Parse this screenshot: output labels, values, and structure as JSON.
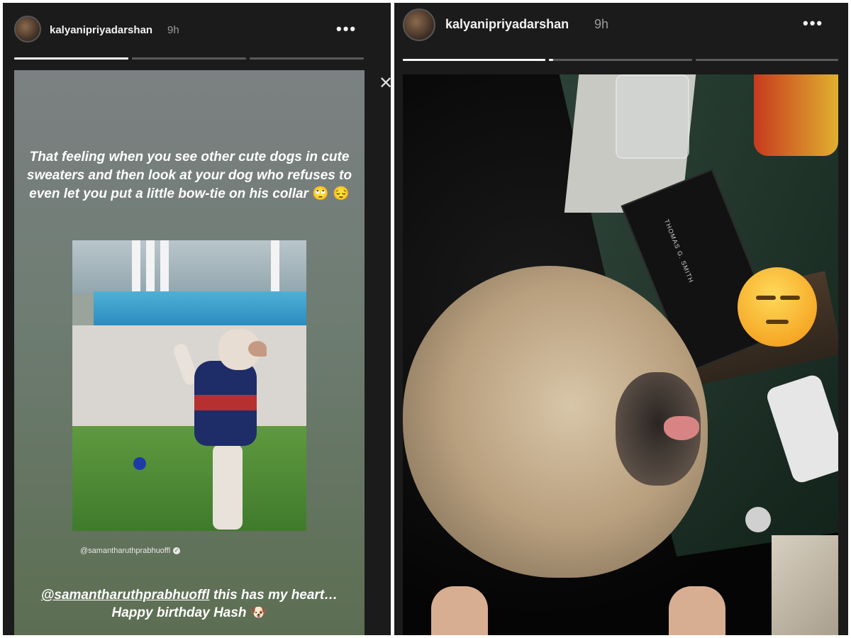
{
  "left_story": {
    "username": "kalyanipriyadarshan",
    "time": "9h",
    "more_glyph": "•••",
    "progress": [
      1.0,
      0.0,
      0.0
    ],
    "close_glyph": "✕",
    "caption": "That feeling when you see other cute dogs in cute sweaters and then look at your dog who refuses to even let you put a little bow-tie on his collar",
    "caption_emojis": "🙄 😔",
    "photo_credit": "@samantharuthprabhuoffl",
    "verified_glyph": "✓",
    "mention_handle": "@samantharuthprabhuoffl",
    "mention_text": " this has my heart… Happy birthday Hash",
    "mention_emoji": "🐶"
  },
  "right_story": {
    "username": "kalyanipriyadarshan",
    "time": "9h",
    "more_glyph": "•••",
    "progress": [
      1.0,
      0.03,
      0.0
    ],
    "book_title": "THOMAS G. SMITH",
    "sticker_name": "unamused-face-emoji"
  }
}
